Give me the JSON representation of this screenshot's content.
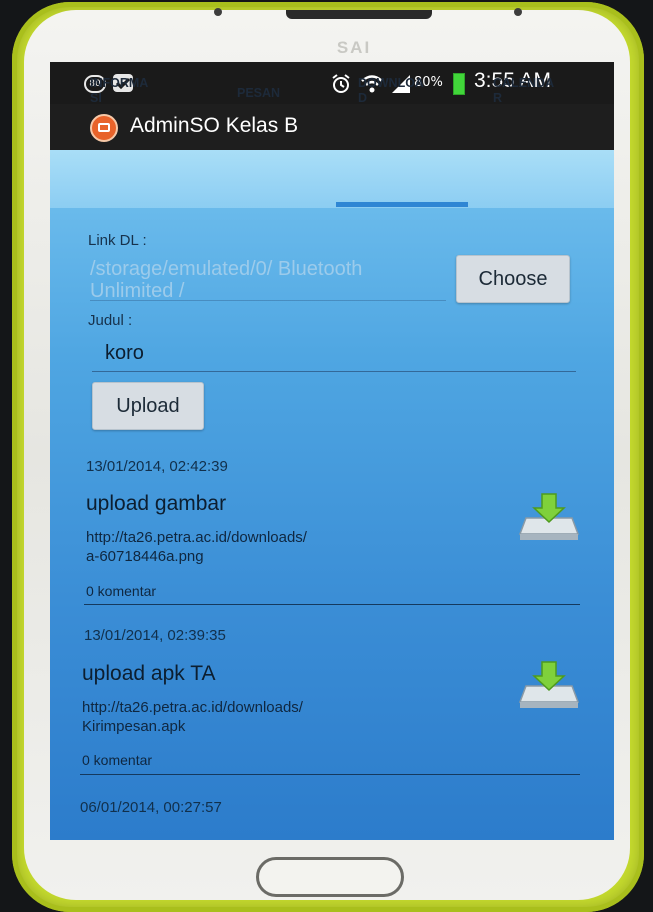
{
  "device": {
    "brand": "SAI"
  },
  "status_bar": {
    "notification_icons": [
      "app-notification-icon",
      "checkmark-icon"
    ],
    "badge_text": "80",
    "battery_percent": "80%",
    "time": "3:55 AM",
    "icons": [
      "alarm-icon",
      "wifi-icon",
      "signal-icon",
      "battery-icon"
    ]
  },
  "app": {
    "title": "AdminSO Kelas B"
  },
  "tabs": [
    {
      "label": "INFORMA\nSI"
    },
    {
      "label": "PESAN"
    },
    {
      "label": "DOWNLOA\nD",
      "active": true
    },
    {
      "label": "CALENDA\nR"
    }
  ],
  "form": {
    "link_label": "Link DL :",
    "link_value": "/storage/emulated/0/ Bluetooth Unlimited /",
    "choose_label": "Choose",
    "judul_label": "Judul :",
    "judul_value": "koro",
    "upload_label": "Upload"
  },
  "items": [
    {
      "date": "13/01/2014, 02:42:39",
      "title": "upload gambar",
      "url": "http://ta26.petra.ac.id/downloads/\na-60718446a.png",
      "comments": "0 komentar"
    },
    {
      "date": "13/01/2014, 02:39:35",
      "title": "upload apk TA",
      "url": "http://ta26.petra.ac.id/downloads/\nKirimpesan.apk",
      "comments": "0 komentar"
    },
    {
      "date": "06/01/2014, 00:27:57"
    }
  ],
  "colors": {
    "case": "#c6dc2e",
    "content_top": "#74c2ef",
    "content_bottom": "#2c7ccb",
    "tab_indicator": "#2f86d4"
  }
}
